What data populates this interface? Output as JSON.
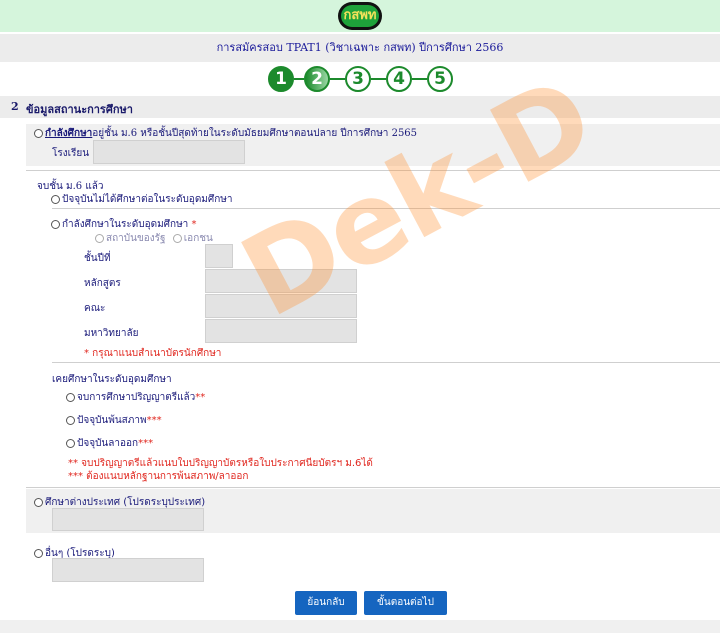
{
  "header": {
    "logo_text": "กสพท",
    "title": "การสมัครสอบ TPAT1 (วิชาเฉพาะ กสพท) ปีการศึกษา 2566"
  },
  "steps": [
    "1",
    "2",
    "3",
    "4",
    "5"
  ],
  "section": {
    "number": "2",
    "title": "ข้อมูลสถานะการศึกษา"
  },
  "option_current": {
    "label_strong": "กำลังศึกษา",
    "label_rest": "อยู่ชั้น ม.6 หรือชั้นปีสุดท้ายในระดับมัธยมศึกษาตอนปลาย ปีการศึกษา 2565",
    "school_label": "โรงเรียน"
  },
  "graduated": {
    "heading": "จบชั้น ม.6 แล้ว",
    "not_studying": "ปัจจุบันไม่ได้ศึกษาต่อในระดับอุดมศึกษา",
    "studying_higher": "กำลังศึกษาในระดับอุดมศึกษา",
    "required_mark": "*",
    "public_label": "สถาบันของรัฐ",
    "private_label": "เอกชน",
    "year_label": "ชั้นปีที่",
    "program_label": "หลักสูตร",
    "faculty_label": "คณะ",
    "university_label": "มหาวิทยาลัย",
    "student_card_note": "* กรุณาแนบสำเนาบัตรนักศึกษา"
  },
  "former_higher": {
    "heading": "เคยศึกษาในระดับอุดมศึกษา",
    "graduated_bachelor": "จบการศึกษาปริญญาตรีแล้ว",
    "graduated_mark": "**",
    "dismissed": "ปัจจุบันพ้นสภาพ",
    "dismissed_mark": "***",
    "withdrawn": "ปัจจุบันลาออก",
    "withdrawn_mark": "***",
    "note1": "** จบปริญญาตรีแล้วแนบใบปริญญาบัตรหรือใบประกาศนียบัตรฯ ม.6ได้",
    "note2": "*** ต้องแนบหลักฐานการพ้นสภาพ/ลาออก"
  },
  "abroad": {
    "label": "ศึกษาต่างประเทศ (โปรดระบุประเทศ)"
  },
  "other": {
    "label": "อื่นๆ (โปรดระบุ)"
  },
  "buttons": {
    "back": "ย้อนกลับ",
    "next": "ขั้นตอนต่อไป"
  },
  "watermark": "Dek-D",
  "colors": {
    "accent_green": "#1c8a2c",
    "button_blue": "#1565c0",
    "required_red": "#e0261e",
    "text_navy": "#1a1a7a"
  }
}
